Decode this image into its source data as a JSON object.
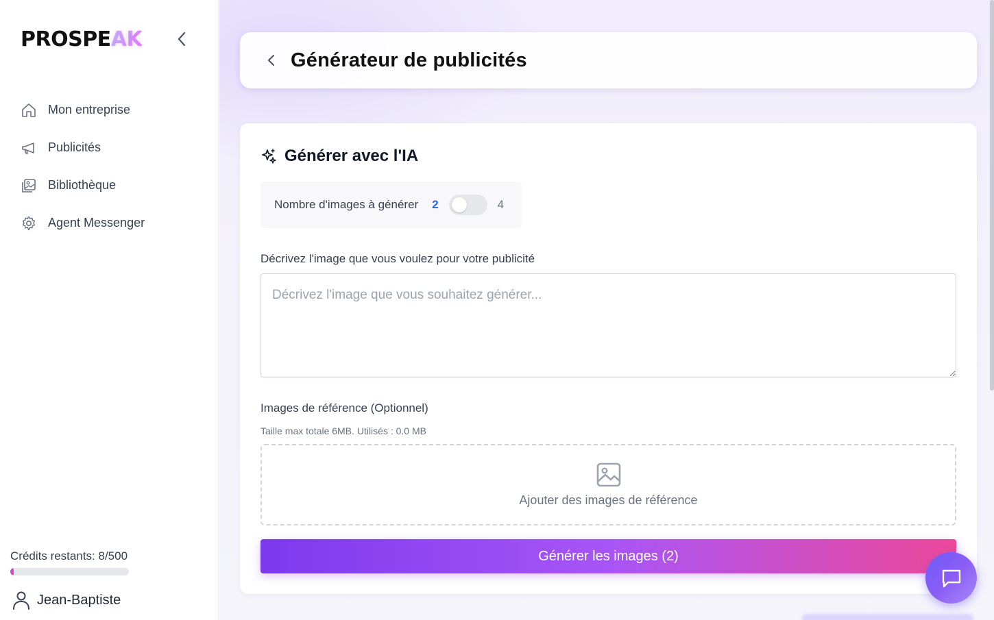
{
  "app": {
    "logo_main": "PROSPE",
    "logo_accent": "AK"
  },
  "sidebar": {
    "items": [
      {
        "label": "Mon entreprise",
        "icon": "home-icon"
      },
      {
        "label": "Publicités",
        "icon": "megaphone-icon"
      },
      {
        "label": "Bibliothèque",
        "icon": "library-icon"
      },
      {
        "label": "Agent Messenger",
        "icon": "gear-icon"
      }
    ],
    "credits_label": "Crédits restants: 8/500",
    "credits_used": 8,
    "credits_total": 500,
    "user_name": "Jean-Baptiste"
  },
  "header": {
    "title": "Générateur de publicités"
  },
  "generator": {
    "section_title": "Générer avec l'IA",
    "count_label": "Nombre d'images à générer",
    "count_option_a": "2",
    "count_option_b": "4",
    "toggle_on": false,
    "description_label": "Décrivez l'image que vous voulez pour votre publicité",
    "description_placeholder": "Décrivez l'image que vous souhaitez générer...",
    "description_value": "",
    "reference_label": "Images de référence (Optionnel)",
    "reference_hint": "Taille max totale 6MB. Utilisés : 0.0 MB",
    "dropzone_text": "Ajouter des images de référence",
    "generate_button": "Générer les images (2)"
  },
  "colors": {
    "accent_blue": "#2563eb",
    "button_gradient_start": "#7c3aed",
    "button_gradient_end": "#ec4899",
    "chat_button": "#7c5cf6"
  }
}
